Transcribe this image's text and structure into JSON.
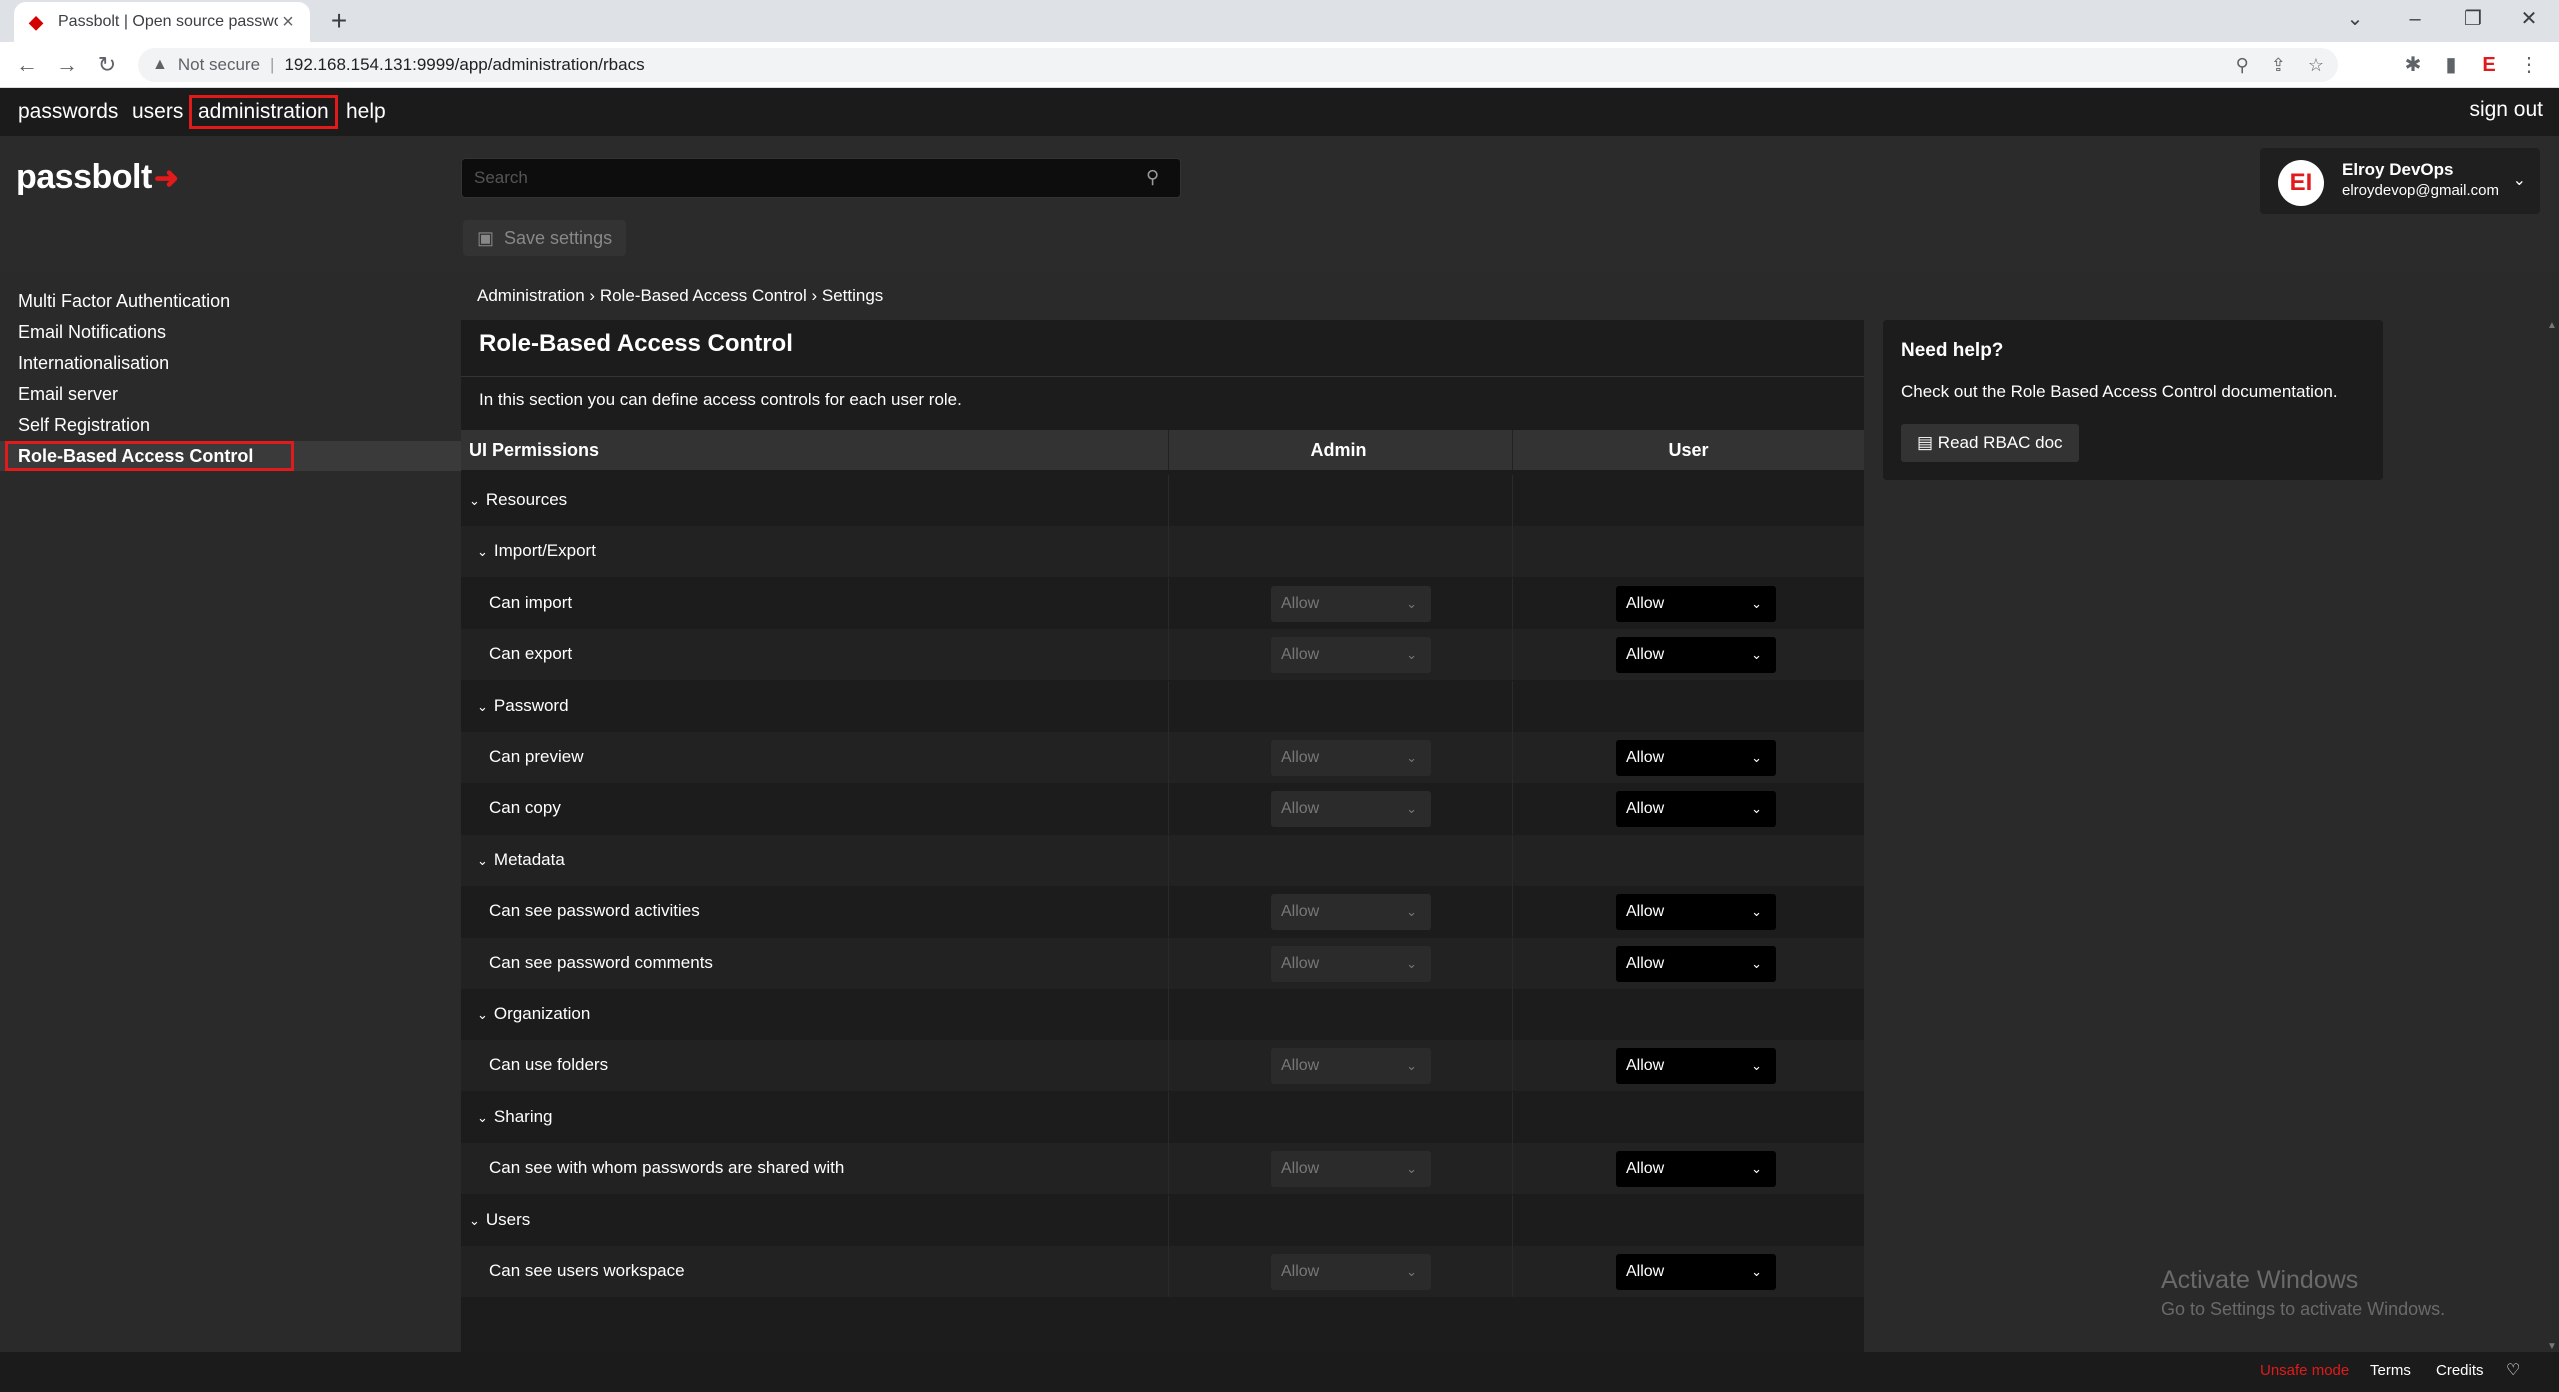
{
  "browser": {
    "tab_title": "Passbolt | Open source passwor",
    "not_secure": "Not secure",
    "url": "192.168.154.131:9999/app/administration/rbacs"
  },
  "topnav": {
    "passwords": "passwords",
    "users": "users",
    "administration": "administration",
    "help": "help",
    "sign_out": "sign out"
  },
  "header": {
    "logo": "passbolt",
    "search_placeholder": "Search",
    "save_settings": "Save settings",
    "user_name": "Elroy DevOps",
    "user_email": "elroydevop@gmail.com",
    "avatar_initials": "EI"
  },
  "sidebar": {
    "items": [
      {
        "label": "Multi Factor Authentication"
      },
      {
        "label": "Email Notifications"
      },
      {
        "label": "Internationalisation"
      },
      {
        "label": "Email server"
      },
      {
        "label": "Self Registration"
      },
      {
        "label": "Role-Based Access Control"
      }
    ]
  },
  "breadcrumb": "Administration › Role-Based Access Control › Settings",
  "main": {
    "title": "Role-Based Access Control",
    "description": "In this section you can define access controls for each user role.",
    "col_permissions": "UI Permissions",
    "col_admin": "Admin",
    "col_user": "User",
    "rows": [
      {
        "label": "Resources",
        "type": "group"
      },
      {
        "label": "Import/Export",
        "type": "sub"
      },
      {
        "label": "Can import",
        "type": "perm",
        "admin": "Allow",
        "user": "Allow"
      },
      {
        "label": "Can export",
        "type": "perm",
        "admin": "Allow",
        "user": "Allow"
      },
      {
        "label": "Password",
        "type": "sub"
      },
      {
        "label": "Can preview",
        "type": "perm",
        "admin": "Allow",
        "user": "Allow"
      },
      {
        "label": "Can copy",
        "type": "perm",
        "admin": "Allow",
        "user": "Allow"
      },
      {
        "label": "Metadata",
        "type": "sub"
      },
      {
        "label": "Can see password activities",
        "type": "perm",
        "admin": "Allow",
        "user": "Allow"
      },
      {
        "label": "Can see password comments",
        "type": "perm",
        "admin": "Allow",
        "user": "Allow"
      },
      {
        "label": "Organization",
        "type": "sub"
      },
      {
        "label": "Can use folders",
        "type": "perm",
        "admin": "Allow",
        "user": "Allow"
      },
      {
        "label": "Sharing",
        "type": "sub"
      },
      {
        "label": "Can see with whom passwords are shared with",
        "type": "perm",
        "admin": "Allow",
        "user": "Allow"
      },
      {
        "label": "Users",
        "type": "group"
      },
      {
        "label": "Can see users workspace",
        "type": "perm",
        "admin": "Allow",
        "user": "Allow"
      }
    ]
  },
  "help": {
    "title": "Need help?",
    "text": "Check out the Role Based Access Control documentation.",
    "button": "Read RBAC doc"
  },
  "watermark": {
    "line1": "Activate Windows",
    "line2": "Go to Settings to activate Windows."
  },
  "footer": {
    "unsafe": "Unsafe mode",
    "terms": "Terms",
    "credits": "Credits"
  },
  "colors": {
    "accent": "#e11b1b",
    "background": "#2a2a2a",
    "panel": "#1c1c1c"
  }
}
